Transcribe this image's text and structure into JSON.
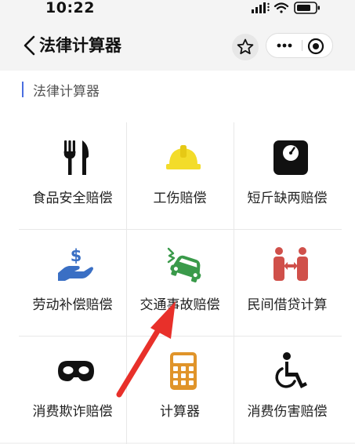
{
  "status_bar": {
    "time": "10:22"
  },
  "nav": {
    "title": "法律计算器"
  },
  "section": {
    "title": "法律计算器"
  },
  "grid": [
    {
      "label": "食品安全赔偿",
      "icon": "fork-knife-icon",
      "color": "#111111"
    },
    {
      "label": "工伤赔偿",
      "icon": "hard-hat-icon",
      "color": "#f3dc2a"
    },
    {
      "label": "短斤缺两赔偿",
      "icon": "scale-icon",
      "color": "#111111"
    },
    {
      "label": "劳动补偿赔偿",
      "icon": "hand-money-icon",
      "color": "#3a6fc4"
    },
    {
      "label": "交通事故赔偿",
      "icon": "car-crash-icon",
      "color": "#3a9a4a"
    },
    {
      "label": "民间借贷计算",
      "icon": "people-exchange-icon",
      "color": "#d0504a"
    },
    {
      "label": "消费欺诈赔偿",
      "icon": "mask-icon",
      "color": "#111111"
    },
    {
      "label": "计算器",
      "icon": "calculator-icon",
      "color": "#e0942a"
    },
    {
      "label": "消费伤害赔偿",
      "icon": "wheelchair-icon",
      "color": "#111111"
    }
  ]
}
